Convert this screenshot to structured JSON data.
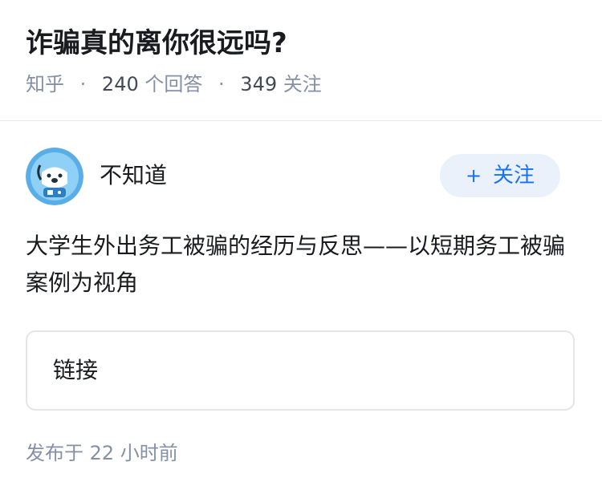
{
  "question": {
    "title": "诈骗真的离你很远吗?",
    "source": "知乎",
    "answer_count": "240",
    "answer_label": "个回答",
    "follower_count": "349",
    "follower_label": "关注",
    "separator": "·"
  },
  "author": {
    "name": "不知道",
    "avatar_icon": "dog-astronaut-avatar"
  },
  "follow_button": {
    "plus": "+",
    "label": "关注"
  },
  "answer": {
    "text": "大学生外出务工被骗的经历与反思——以短期务工被骗案例为视角"
  },
  "link_card": {
    "label": "链接"
  },
  "publish": {
    "prefix": "发布于",
    "time": "22 小时前"
  },
  "colors": {
    "primary": "#1772f6",
    "button_bg": "#eaf1fb",
    "meta_text": "#8590a6",
    "main_text": "#191b1f"
  }
}
